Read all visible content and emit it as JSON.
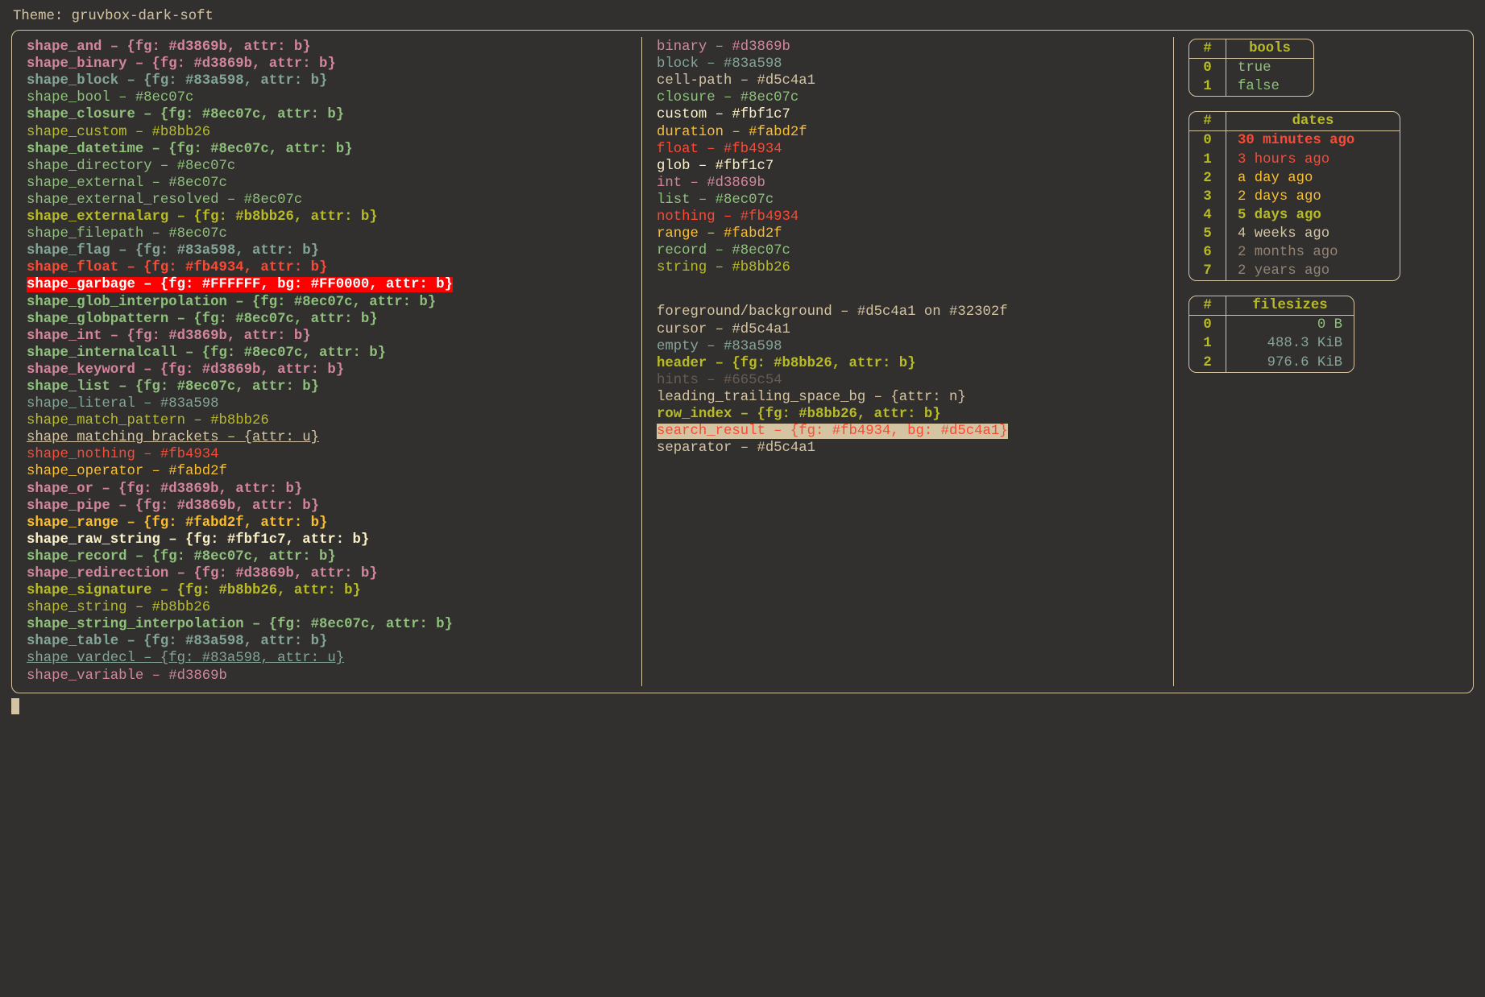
{
  "title_prefix": "Theme: ",
  "title_value": "gruvbox-dark-soft",
  "shapes": [
    {
      "name": "shape_and",
      "value": "{fg: #d3869b, attr: b}",
      "fg": "#d3869b",
      "bold": true
    },
    {
      "name": "shape_binary",
      "value": "{fg: #d3869b, attr: b}",
      "fg": "#d3869b",
      "bold": true
    },
    {
      "name": "shape_block",
      "value": "{fg: #83a598, attr: b}",
      "fg": "#83a598",
      "bold": true
    },
    {
      "name": "shape_bool",
      "value": "#8ec07c",
      "fg": "#8ec07c"
    },
    {
      "name": "shape_closure",
      "value": "{fg: #8ec07c, attr: b}",
      "fg": "#8ec07c",
      "bold": true
    },
    {
      "name": "shape_custom",
      "value": "#b8bb26",
      "fg": "#b8bb26"
    },
    {
      "name": "shape_datetime",
      "value": "{fg: #8ec07c, attr: b}",
      "fg": "#8ec07c",
      "bold": true
    },
    {
      "name": "shape_directory",
      "value": "#8ec07c",
      "fg": "#8ec07c"
    },
    {
      "name": "shape_external",
      "value": "#8ec07c",
      "fg": "#8ec07c"
    },
    {
      "name": "shape_external_resolved",
      "value": "#8ec07c",
      "fg": "#8ec07c"
    },
    {
      "name": "shape_externalarg",
      "value": "{fg: #b8bb26, attr: b}",
      "fg": "#b8bb26",
      "bold": true
    },
    {
      "name": "shape_filepath",
      "value": "#8ec07c",
      "fg": "#8ec07c"
    },
    {
      "name": "shape_flag",
      "value": "{fg: #83a598, attr: b}",
      "fg": "#83a598",
      "bold": true
    },
    {
      "name": "shape_float",
      "value": "{fg: #fb4934, attr: b}",
      "fg": "#fb4934",
      "bold": true
    },
    {
      "name": "shape_garbage",
      "value": "{fg: #FFFFFF, bg: #FF0000, attr: b}",
      "fg": "#FFFFFF",
      "bg": "#FF0000",
      "bold": true
    },
    {
      "name": "shape_glob_interpolation",
      "value": "{fg: #8ec07c, attr: b}",
      "fg": "#8ec07c",
      "bold": true
    },
    {
      "name": "shape_globpattern",
      "value": "{fg: #8ec07c, attr: b}",
      "fg": "#8ec07c",
      "bold": true
    },
    {
      "name": "shape_int",
      "value": "{fg: #d3869b, attr: b}",
      "fg": "#d3869b",
      "bold": true
    },
    {
      "name": "shape_internalcall",
      "value": "{fg: #8ec07c, attr: b}",
      "fg": "#8ec07c",
      "bold": true
    },
    {
      "name": "shape_keyword",
      "value": "{fg: #d3869b, attr: b}",
      "fg": "#d3869b",
      "bold": true
    },
    {
      "name": "shape_list",
      "value": "{fg: #8ec07c, attr: b}",
      "fg": "#8ec07c",
      "bold": true
    },
    {
      "name": "shape_literal",
      "value": "#83a598",
      "fg": "#83a598"
    },
    {
      "name": "shape_match_pattern",
      "value": "#b8bb26",
      "fg": "#b8bb26"
    },
    {
      "name": "shape_matching_brackets",
      "value": "{attr: u}",
      "fg": "#d5c4a1",
      "underline": true
    },
    {
      "name": "shape_nothing",
      "value": "#fb4934",
      "fg": "#fb4934"
    },
    {
      "name": "shape_operator",
      "value": "#fabd2f",
      "fg": "#fabd2f"
    },
    {
      "name": "shape_or",
      "value": "{fg: #d3869b, attr: b}",
      "fg": "#d3869b",
      "bold": true
    },
    {
      "name": "shape_pipe",
      "value": "{fg: #d3869b, attr: b}",
      "fg": "#d3869b",
      "bold": true
    },
    {
      "name": "shape_range",
      "value": "{fg: #fabd2f, attr: b}",
      "fg": "#fabd2f",
      "bold": true
    },
    {
      "name": "shape_raw_string",
      "value": "{fg: #fbf1c7, attr: b}",
      "fg": "#fbf1c7",
      "bold": true
    },
    {
      "name": "shape_record",
      "value": "{fg: #8ec07c, attr: b}",
      "fg": "#8ec07c",
      "bold": true
    },
    {
      "name": "shape_redirection",
      "value": "{fg: #d3869b, attr: b}",
      "fg": "#d3869b",
      "bold": true
    },
    {
      "name": "shape_signature",
      "value": "{fg: #b8bb26, attr: b}",
      "fg": "#b8bb26",
      "bold": true
    },
    {
      "name": "shape_string",
      "value": "#b8bb26",
      "fg": "#b8bb26"
    },
    {
      "name": "shape_string_interpolation",
      "value": "{fg: #8ec07c, attr: b}",
      "fg": "#8ec07c",
      "bold": true
    },
    {
      "name": "shape_table",
      "value": "{fg: #83a598, attr: b}",
      "fg": "#83a598",
      "bold": true
    },
    {
      "name": "shape_vardecl",
      "value": "{fg: #83a598, attr: u}",
      "fg": "#83a598",
      "underline": true
    },
    {
      "name": "shape_variable",
      "value": "#d3869b",
      "fg": "#d3869b"
    }
  ],
  "types": [
    {
      "name": "binary",
      "value": "#d3869b",
      "fg": "#d3869b"
    },
    {
      "name": "block",
      "value": "#83a598",
      "fg": "#83a598"
    },
    {
      "name": "cell-path",
      "value": "#d5c4a1",
      "fg": "#d5c4a1"
    },
    {
      "name": "closure",
      "value": "#8ec07c",
      "fg": "#8ec07c"
    },
    {
      "name": "custom",
      "value": "#fbf1c7",
      "fg": "#fbf1c7"
    },
    {
      "name": "duration",
      "value": "#fabd2f",
      "fg": "#fabd2f"
    },
    {
      "name": "float",
      "value": "#fb4934",
      "fg": "#fb4934"
    },
    {
      "name": "glob",
      "value": "#fbf1c7",
      "fg": "#fbf1c7"
    },
    {
      "name": "int",
      "value": "#d3869b",
      "fg": "#d3869b"
    },
    {
      "name": "list",
      "value": "#8ec07c",
      "fg": "#8ec07c"
    },
    {
      "name": "nothing",
      "value": "#fb4934",
      "fg": "#fb4934"
    },
    {
      "name": "range",
      "value": "#fabd2f",
      "fg": "#fabd2f"
    },
    {
      "name": "record",
      "value": "#8ec07c",
      "fg": "#8ec07c"
    },
    {
      "name": "string",
      "value": "#b8bb26",
      "fg": "#b8bb26"
    }
  ],
  "misc": [
    {
      "name": "foreground/background",
      "value": "#d5c4a1 on #32302f",
      "fg": "#d5c4a1"
    },
    {
      "name": "cursor",
      "value": "#d5c4a1",
      "fg": "#d5c4a1"
    },
    {
      "name": "empty",
      "value": "#83a598",
      "fg": "#83a598"
    },
    {
      "name": "header",
      "value": "{fg: #b8bb26, attr: b}",
      "fg": "#b8bb26",
      "bold": true
    },
    {
      "name": "hints",
      "value": "#665c54",
      "fg": "#665c54"
    },
    {
      "name": "leading_trailing_space_bg",
      "value": "{attr: n}",
      "fg": "#d5c4a1"
    },
    {
      "name": "row_index",
      "value": "{fg: #b8bb26, attr: b}",
      "fg": "#b8bb26",
      "bold": true
    },
    {
      "name": "search_result",
      "value": "{fg: #fb4934, bg: #d5c4a1}",
      "fg": "#fb4934",
      "bg": "#d5c4a1"
    },
    {
      "name": "separator",
      "value": "#d5c4a1",
      "fg": "#d5c4a1"
    }
  ],
  "bools": {
    "header": {
      "idx": "#",
      "label": "bools"
    },
    "rows": [
      {
        "idx": "0",
        "val": "true",
        "fg": "#8ec07c"
      },
      {
        "idx": "1",
        "val": "false",
        "fg": "#8ec07c"
      }
    ]
  },
  "dates": {
    "header": {
      "idx": "#",
      "label": "dates"
    },
    "rows": [
      {
        "idx": "0",
        "val": "30 minutes ago",
        "fg": "#fb4934",
        "bold": true
      },
      {
        "idx": "1",
        "val": "3 hours ago",
        "fg": "#fb4934"
      },
      {
        "idx": "2",
        "val": "a day ago",
        "fg": "#fabd2f"
      },
      {
        "idx": "3",
        "val": "2 days ago",
        "fg": "#fabd2f"
      },
      {
        "idx": "4",
        "val": "5 days ago",
        "fg": "#b8bb26",
        "bold": true
      },
      {
        "idx": "5",
        "val": "4 weeks ago",
        "fg": "#d5c4a1"
      },
      {
        "idx": "6",
        "val": "2 months ago",
        "fg": "#928374"
      },
      {
        "idx": "7",
        "val": "2 years ago",
        "fg": "#928374"
      }
    ]
  },
  "filesizes": {
    "header": {
      "idx": "#",
      "label": "filesizes"
    },
    "rows": [
      {
        "idx": "0",
        "val": "0 B",
        "fg": "#8ec07c"
      },
      {
        "idx": "1",
        "val": "488.3 KiB",
        "fg": "#83a598"
      },
      {
        "idx": "2",
        "val": "976.6 KiB",
        "fg": "#83a598"
      }
    ]
  },
  "dash": " – "
}
